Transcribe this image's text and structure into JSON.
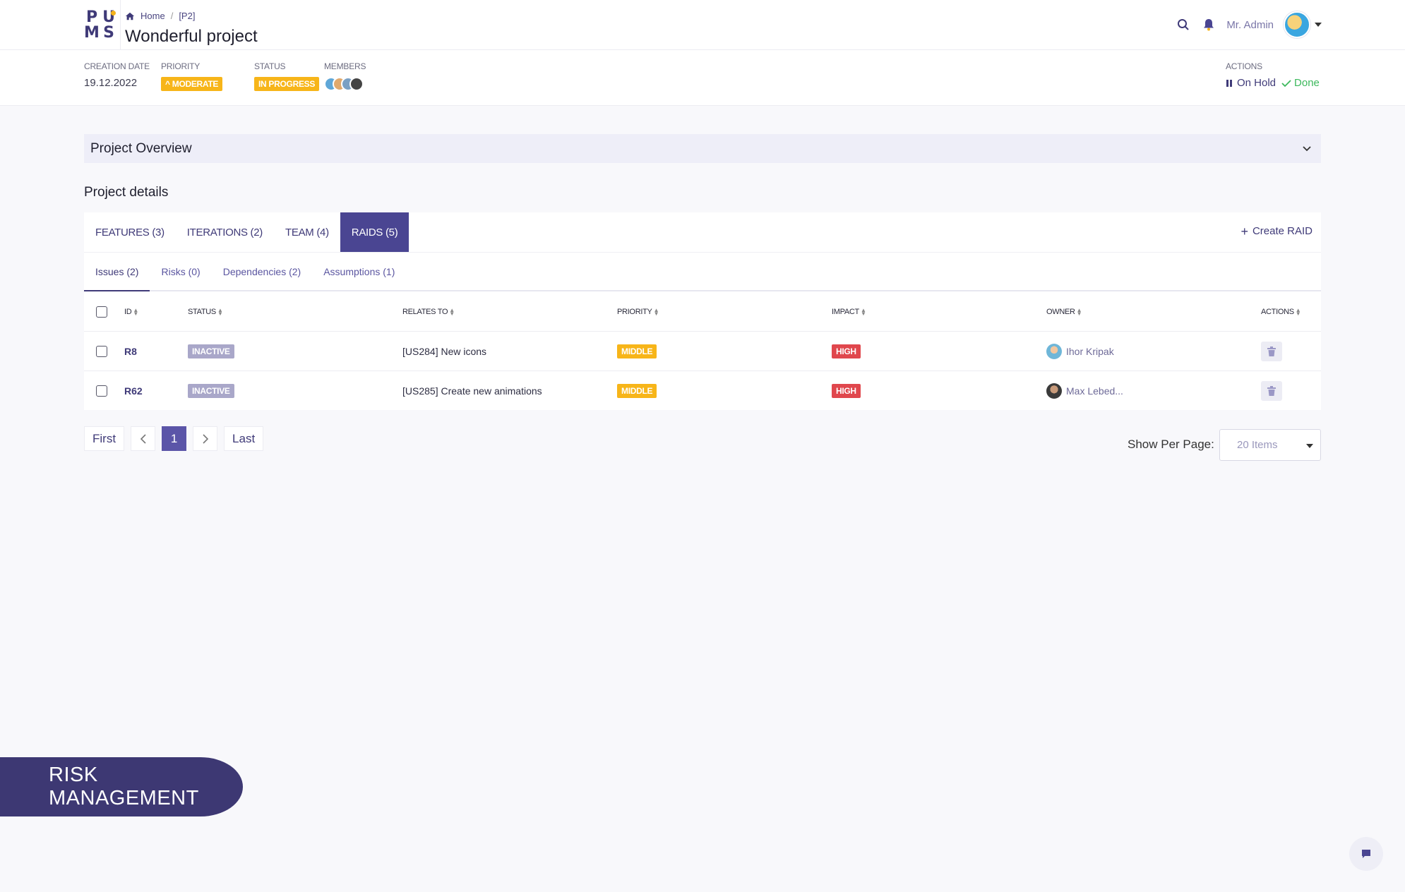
{
  "logo": {
    "letters": [
      "P",
      "U",
      "M",
      "S"
    ]
  },
  "breadcrumb": {
    "home": "Home",
    "project": "[P2]"
  },
  "page_title": "Wonderful project",
  "header": {
    "user": "Mr. Admin"
  },
  "meta": {
    "creation_label": "CREATION DATE",
    "creation_value": "19.12.2022",
    "priority_label": "PRIORITY",
    "priority_value": "MODERATE",
    "status_label": "STATUS",
    "status_value": "IN PROGRESS",
    "members_label": "MEMBERS",
    "actions_label": "ACTIONS",
    "onhold": "On Hold",
    "done": "Done"
  },
  "overview": {
    "title": "Project Overview"
  },
  "details": {
    "title": "Project details"
  },
  "tabs": [
    {
      "label": "FEATURES (3)"
    },
    {
      "label": "ITERATIONS (2)"
    },
    {
      "label": "TEAM (4)"
    },
    {
      "label": "RAIDS (5)"
    }
  ],
  "create_raid": "Create RAID",
  "subtabs": [
    {
      "label": "Issues (2)"
    },
    {
      "label": "Risks (0)"
    },
    {
      "label": "Dependencies (2)"
    },
    {
      "label": "Assumptions (1)"
    }
  ],
  "table": {
    "headers": {
      "id": "ID",
      "status": "STATUS",
      "relates": "RELATES TO",
      "priority": "PRIORITY",
      "impact": "IMPACT",
      "owner": "OWNER",
      "actions": "ACTIONS"
    },
    "rows": [
      {
        "id": "R8",
        "status": "INACTIVE",
        "relates": "[US284] New icons",
        "priority": "MIDDLE",
        "impact": "HIGH",
        "owner": "Ihor Kripak"
      },
      {
        "id": "R62",
        "status": "INACTIVE",
        "relates": "[US285] Create new animations",
        "priority": "MIDDLE",
        "impact": "HIGH",
        "owner": "Max Lebed..."
      }
    ]
  },
  "pager": {
    "first": "First",
    "page": "1",
    "last": "Last"
  },
  "per_page": {
    "label": "Show Per Page:",
    "value": "20 Items"
  },
  "banner": "RISK MANAGEMENT",
  "colors": {
    "accent": "#4a4592",
    "yellow": "#f7b519",
    "red": "#e0474d",
    "inactive": "#a9a7c9"
  }
}
